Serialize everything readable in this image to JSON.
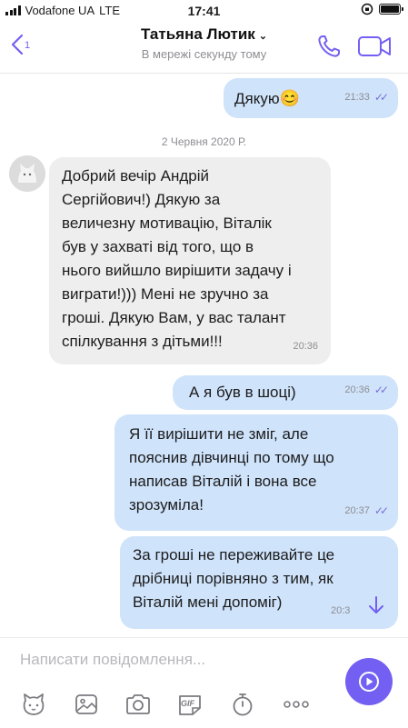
{
  "status_bar": {
    "carrier": "Vodafone UA",
    "network": "LTE",
    "time": "17:41"
  },
  "header": {
    "title": "Татьяна Лютик",
    "subtitle": "В мережі секунду тому",
    "back_badge": "1"
  },
  "messages": [
    {
      "direction": "out",
      "text": "Дякую",
      "emoji": "😊",
      "time": "21:33"
    },
    {
      "direction": "in",
      "lines": [
        "Добрий вечір Андрій",
        "Сергійович!) Дякую за",
        "величезну мотивацію, Віталік",
        "був у захваті від того, що в",
        "нього вийшло вирішити задачу і",
        "виграти!))) Мені не зручно за",
        "гроші. Дякую Вам, у вас талант",
        "спілкування з дітьми!!!"
      ],
      "time": "20:36"
    },
    {
      "direction": "out",
      "text": "А я був в шоці)",
      "time": "20:36"
    },
    {
      "direction": "out",
      "lines": [
        "Я її вирішити не зміг, але",
        "пояснив дівчинці по тому що",
        "написав Віталій і вона все",
        "зрозуміла!"
      ],
      "time": "20:37"
    },
    {
      "direction": "out",
      "lines": [
        "За гроші не переживайте це",
        "дрібниці порівняно з тим, як",
        "Віталій мені допоміг)"
      ],
      "time": "20:3"
    }
  ],
  "date_separator": "2 Червня 2020 Р.",
  "composer": {
    "placeholder": "Написати повідомлення..."
  },
  "toolbar": {
    "icons": [
      "sticker-icon",
      "gallery-icon",
      "camera-icon",
      "gif-icon",
      "timer-icon",
      "more-icon"
    ],
    "gif_label": "GIF"
  },
  "colors": {
    "accent": "#7360f2",
    "outgoing": "#cfe3fb",
    "incoming": "#eeeeee"
  }
}
